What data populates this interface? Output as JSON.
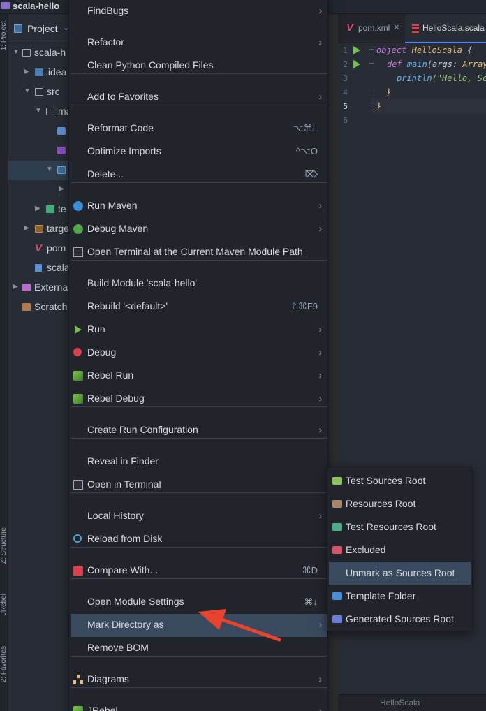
{
  "titlebar": {
    "project_name": "scala-hello"
  },
  "left_strip": {
    "tab_project": "1: Project",
    "tab_structure": "Z: Structure",
    "tab_jrebel": "JRebel",
    "tab_favorites": "2: Favorites"
  },
  "project_panel": {
    "header": "Project",
    "tree": [
      {
        "label": "scala-h",
        "indent": 1
      },
      {
        "label": ".idea",
        "indent": 2
      },
      {
        "label": "src",
        "indent": 2
      },
      {
        "label": "ma",
        "indent": 3
      },
      {
        "label": "",
        "indent": 4
      },
      {
        "label": "",
        "indent": 4
      },
      {
        "label": "",
        "indent": 4
      },
      {
        "label": "",
        "indent": 5
      },
      {
        "label": "te",
        "indent": 3
      },
      {
        "label": "targe",
        "indent": 2
      },
      {
        "label": "pom",
        "indent": 2
      },
      {
        "label": "scala",
        "indent": 2
      },
      {
        "label": "Externa",
        "indent": 1
      },
      {
        "label": "Scratch",
        "indent": 1
      }
    ]
  },
  "editor": {
    "tabs": [
      {
        "label": "pom.xml",
        "close": "×"
      },
      {
        "label": "HelloScala.scala"
      }
    ],
    "line_numbers": [
      "1",
      "2",
      "3",
      "4",
      "5",
      "6"
    ],
    "code": {
      "l1_kw": "object",
      "l1_name": "HelloScala",
      "l1_brace": "{",
      "l2_kw": "def",
      "l2_fn": "main",
      "l2_args": "(args: ",
      "l2_type": "Array[",
      "l3_fn": "println",
      "l3_str": "(\"Hello, Sca",
      "l4": "}",
      "l5": "}"
    },
    "footer": "HelloScala"
  },
  "menu": {
    "items": [
      {
        "label": "FindBugs",
        "submenu": true
      },
      {
        "label": "Refactor",
        "submenu": true
      },
      {
        "label": "Clean Python Compiled Files"
      },
      {
        "label": "Add to Favorites",
        "submenu": true
      },
      {
        "label": "Reformat Code",
        "shortcut": "⌥⌘L"
      },
      {
        "label": "Optimize Imports",
        "shortcut": "^⌥O"
      },
      {
        "label": "Delete...",
        "shortcut": "⌦"
      },
      {
        "label": "Run Maven",
        "submenu": true,
        "icon": "maven-gear-icon"
      },
      {
        "label": "Debug Maven",
        "submenu": true,
        "icon": "maven-debug-gear-icon"
      },
      {
        "label": "Open Terminal at the Current Maven Module Path",
        "icon": "terminal-icon"
      },
      {
        "label": "Build Module 'scala-hello'"
      },
      {
        "label": "Rebuild '<default>'",
        "shortcut": "⇧⌘F9"
      },
      {
        "label": "Run",
        "submenu": true,
        "icon": "run-icon"
      },
      {
        "label": "Debug",
        "submenu": true,
        "icon": "debug-icon"
      },
      {
        "label": "Rebel Run",
        "submenu": true,
        "icon": "jrebel-run-icon"
      },
      {
        "label": "Rebel Debug",
        "submenu": true,
        "icon": "jrebel-debug-icon"
      },
      {
        "label": "Create Run Configuration",
        "submenu": true
      },
      {
        "label": "Reveal in Finder"
      },
      {
        "label": "Open in Terminal",
        "icon": "terminal-icon"
      },
      {
        "label": "Local History",
        "submenu": true
      },
      {
        "label": "Reload from Disk",
        "icon": "reload-icon"
      },
      {
        "label": "Compare With...",
        "shortcut": "⌘D",
        "icon": "compare-icon"
      },
      {
        "label": "Open Module Settings",
        "shortcut": "⌘↓"
      },
      {
        "label": "Mark Directory as",
        "submenu": true,
        "highlighted": true
      },
      {
        "label": "Remove BOM"
      },
      {
        "label": "Diagrams",
        "submenu": true,
        "icon": "diagram-icon"
      },
      {
        "label": "JRebel",
        "submenu": true,
        "icon": "jrebel-icon"
      }
    ]
  },
  "submenu": {
    "items": [
      {
        "label": "Test Sources Root",
        "color": "#8fbf5a"
      },
      {
        "label": "Resources Root",
        "color": "#a5866b"
      },
      {
        "label": "Test Resources Root",
        "color": "#4fae8a"
      },
      {
        "label": "Excluded",
        "color": "#d4546a"
      },
      {
        "label": "Unmark as Sources Root",
        "highlighted": true
      },
      {
        "label": "Template Folder",
        "color": "#4a8fd6"
      },
      {
        "label": "Generated Sources Root",
        "color": "#6c7fd8"
      }
    ]
  },
  "colors": {
    "accent": "#528bff",
    "highlight": "#3a4a5e",
    "annotation_arrow": "#e8432e"
  }
}
